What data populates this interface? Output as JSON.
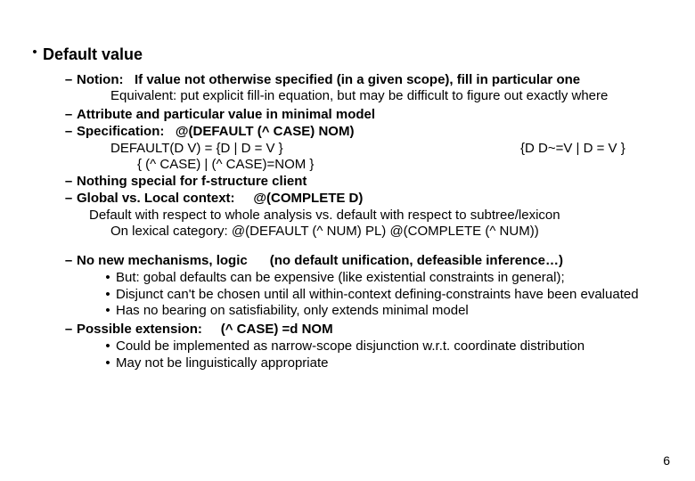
{
  "title": "Default value",
  "notion": {
    "label": "Notion:",
    "text": "If value not otherwise specified (in a given scope), fill in particular one",
    "sub": "Equivalent:  put explicit fill-in equation, but may be difficult to figure out exactly where"
  },
  "attr_line": "Attribute and particular value in minimal model",
  "spec": {
    "label": "Specification:",
    "macro": "@(DEFAULT (^ CASE) NOM)",
    "def_left_1": "DEFAULT(D V) = {D | D = V }",
    "def_left_2": "{ (^ CASE) | (^ CASE)=NOM }",
    "def_right": "{D  D~=V | D = V }"
  },
  "fstruct": "Nothing special for f-structure client",
  "global": {
    "label": "Global vs. Local context:",
    "macro": "@(COMPLETE D)",
    "sub1": "Default with respect to whole analysis vs. default with respect to subtree/lexicon",
    "sub2": "On lexical category:    @(DEFAULT (^ NUM) PL)   @(COMPLETE (^ NUM))"
  },
  "nonew": {
    "label": "No new mechanisms, logic",
    "paren": "(no default unification, defeasible inference…)",
    "b1": "But: gobal defaults can be expensive (like existential constraints in general);",
    "b2": "Disjunct can't be chosen until all within-context defining-constraints have been evaluated",
    "b3": "Has no bearing on satisfiability, only extends minimal model"
  },
  "ext": {
    "label": "Possible extension:",
    "code": "(^ CASE) =d NOM",
    "b1": "Could be implemented as narrow-scope disjunction w.r.t. coordinate distribution",
    "b2": "May not be linguistically appropriate"
  },
  "pagenum": "6",
  "glyph": {
    "bullet": "•",
    "dash": "–"
  }
}
